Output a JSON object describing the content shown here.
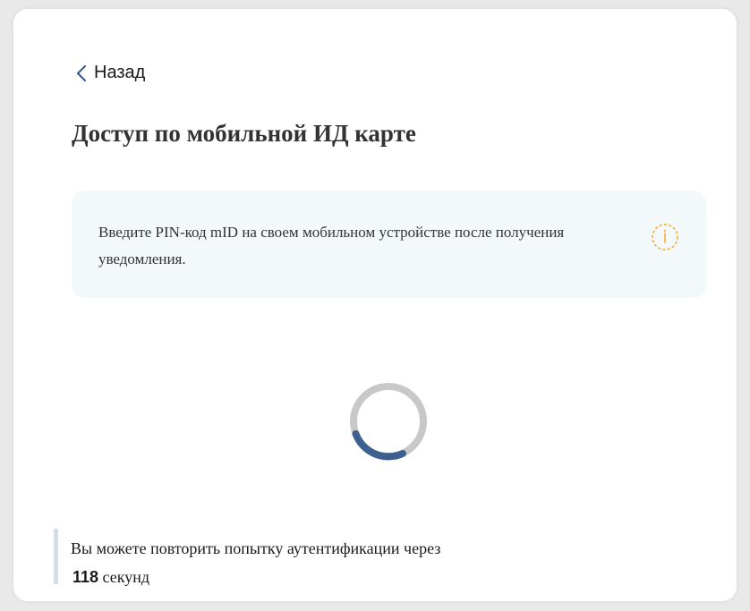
{
  "back": {
    "label": "Назад",
    "icon": "chevron-left-icon"
  },
  "page": {
    "title": "Доступ по мобильной ИД карте"
  },
  "info": {
    "text": "Введите PIN-код mID на своем мобильном устройстве после получения уведомления.",
    "icon": "info-icon",
    "icon_color": "#f5b545"
  },
  "spinner": {
    "icon": "loading-spinner-icon",
    "track_color": "#c8c8c8",
    "arc_color": "#3b5f8f"
  },
  "retry": {
    "text": "Вы можете повторить попытку аутентификации через",
    "seconds": "118",
    "unit": "секунд"
  },
  "colors": {
    "accent": "#3b5f8f",
    "panel_bg": "#f3f8fb",
    "divider": "#d6dde8"
  }
}
